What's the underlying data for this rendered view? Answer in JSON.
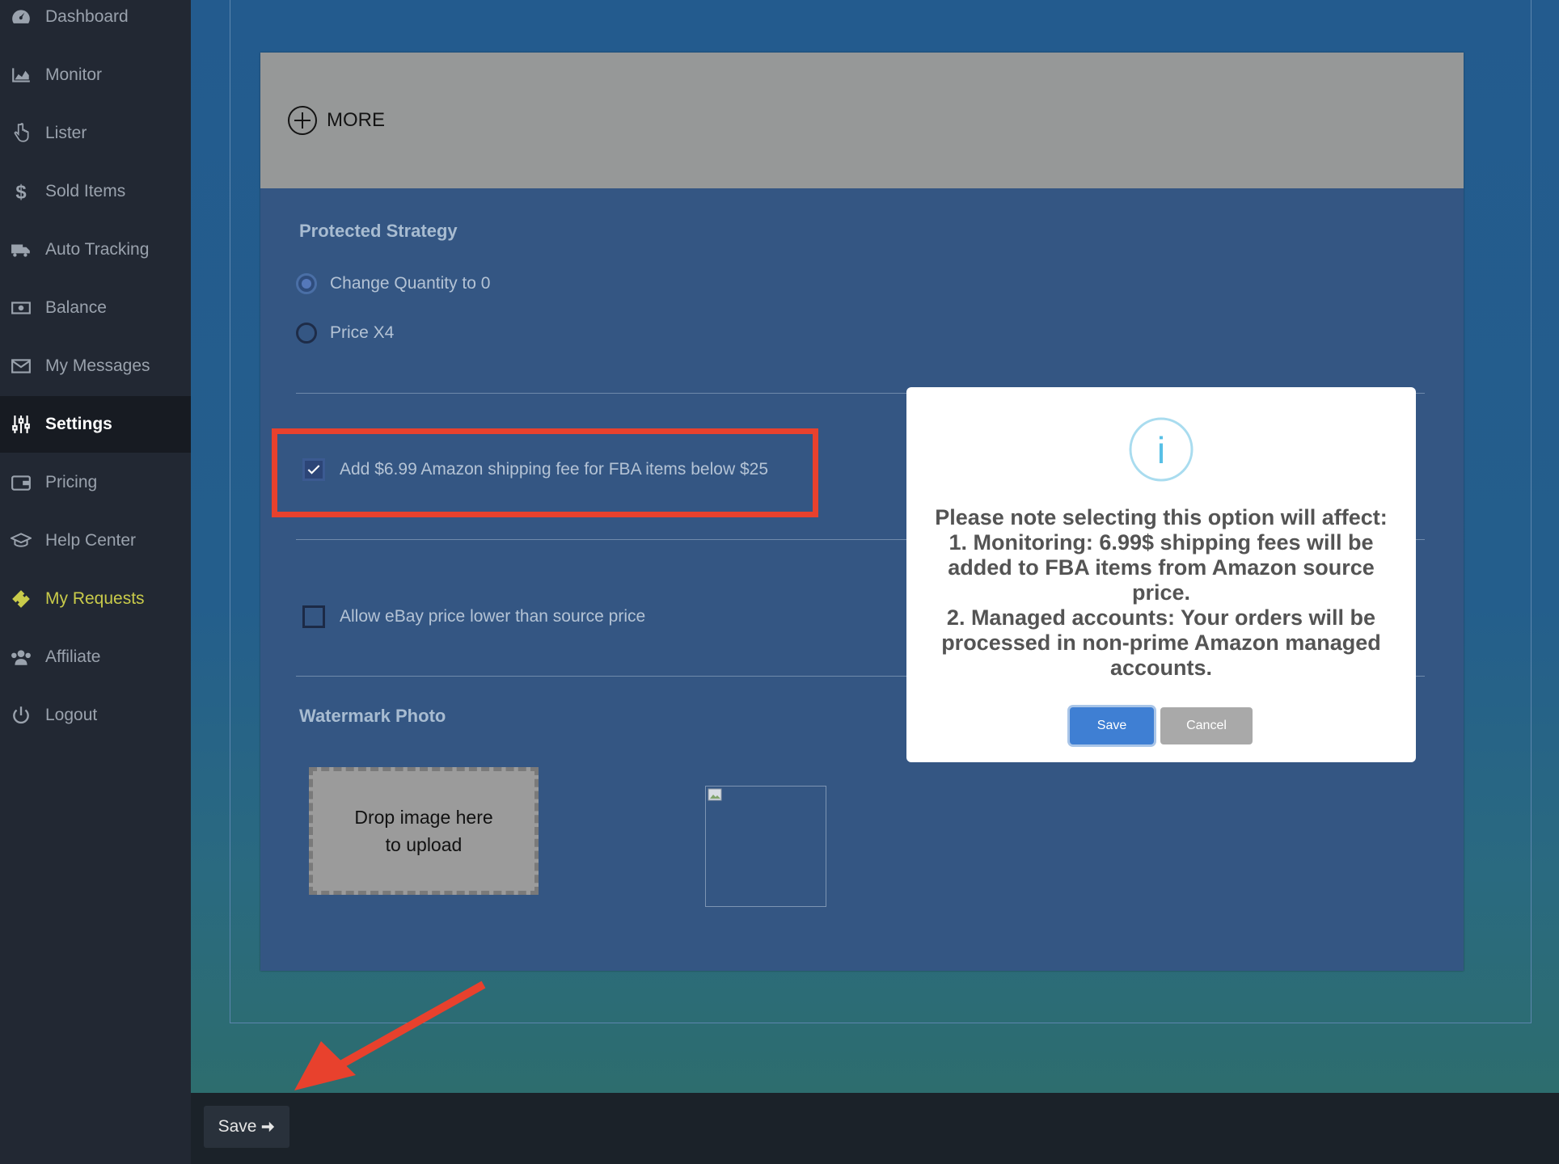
{
  "sidebar": {
    "items": [
      {
        "label": "Dashboard",
        "icon": "dashboard-icon"
      },
      {
        "label": "Monitor",
        "icon": "area-chart-icon"
      },
      {
        "label": "Lister",
        "icon": "hand-pointer-icon"
      },
      {
        "label": "Sold Items",
        "icon": "dollar-icon"
      },
      {
        "label": "Auto Tracking",
        "icon": "truck-icon"
      },
      {
        "label": "Balance",
        "icon": "money-bill-icon"
      },
      {
        "label": "My Messages",
        "icon": "envelope-icon"
      },
      {
        "label": "Settings",
        "icon": "sliders-icon",
        "active": true
      },
      {
        "label": "Pricing",
        "icon": "wallet-icon"
      },
      {
        "label": "Help Center",
        "icon": "graduation-cap-icon"
      },
      {
        "label": "My Requests",
        "icon": "ticket-icon",
        "highlight": true
      },
      {
        "label": "Affiliate",
        "icon": "users-icon"
      },
      {
        "label": "Logout",
        "icon": "power-icon"
      }
    ]
  },
  "main": {
    "more_label": "MORE",
    "protected_strategy": {
      "title": "Protected Strategy",
      "options": [
        {
          "label": "Change Quantity to 0",
          "checked": true
        },
        {
          "label": "Price X4",
          "checked": false
        }
      ]
    },
    "shipping_fee_checkbox": {
      "label": "Add $6.99 Amazon shipping fee for FBA items below $25",
      "checked": true
    },
    "allow_lower_price_checkbox": {
      "label": "Allow eBay price lower than source price",
      "checked": false
    },
    "watermark": {
      "title": "Watermark Photo",
      "dropzone_line1": "Drop image here",
      "dropzone_line2": "to upload"
    }
  },
  "footer": {
    "save_label": "Save"
  },
  "modal": {
    "icon": "info-icon",
    "lines": [
      "Please note selecting this option will affect:",
      "1. Monitoring: 6.99$ shipping fees will be added to FBA items from Amazon source price.",
      "2. Managed accounts: Your orders will be processed in non-prime Amazon managed accounts."
    ],
    "save_label": "Save",
    "cancel_label": "Cancel"
  },
  "colors": {
    "sidebar_bg": "#222833",
    "main_bg": "#235b8e",
    "panel_bg": "#345683",
    "highlight_box": "#e8412d",
    "primary_button": "#3f7fd3",
    "requests_accent": "#c9cb4a"
  }
}
